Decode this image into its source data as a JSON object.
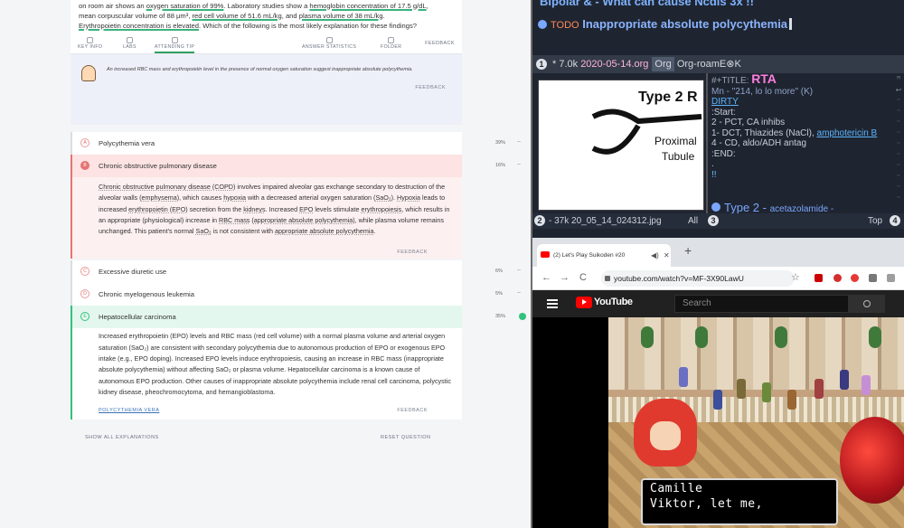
{
  "question": {
    "t1": "on room air shows an ",
    "h1": "oxygen saturation of 99%",
    "t2": ". Laboratory studies show a ",
    "h2": "hemoglobin concentration of 17.5 g/dL",
    "t3": ",",
    "t4": "mean corpuscular volume of 88 μm³, ",
    "h3": "red cell volume of 51.6 mL/kg",
    "t5": ", and ",
    "h4": "plasma volume of 38 mL/kg",
    "t6": ".",
    "h5": "Erythropoietin concentration is elevated",
    "t7": ". Which of the following is the most likely explanation for these findings?"
  },
  "toolbar": {
    "key_info": "KEY INFO",
    "labs": "LABS",
    "attending_tip": "ATTENDING TIP",
    "answer_statistics": "ANSWER STATISTICS",
    "folder": "FOLDER",
    "feedback": "FEEDBACK"
  },
  "tip": {
    "text": "An increased RBC mass and erythropoietin level in the presence of normal oxygen saturation suggest inappropriate absolute polycythemia.",
    "feedback": "FEEDBACK"
  },
  "options": [
    {
      "letter": "A",
      "label": "Polycythemia vera",
      "pct": "39%"
    },
    {
      "letter": "B",
      "label": "Chronic obstructive pulmonary disease",
      "pct": "16%"
    },
    {
      "letter": "C",
      "label": "Excessive diuretic use",
      "pct": "6%"
    },
    {
      "letter": "D",
      "label": "Chronic myelogenous leukemia",
      "pct": "5%"
    },
    {
      "letter": "E",
      "label": "Hepatocellular carcinoma",
      "pct": "35%"
    }
  ],
  "explB": {
    "p1": "Chronic obstructive pulmonary disease (COPD)",
    "p2": " involves impaired alveolar gas exchange secondary to destruction of the alveolar walls (",
    "p3": "emphysema",
    "p4": "), which causes ",
    "p5": "hypoxia",
    "p6": " with a decreased arterial oxygen saturation (",
    "p7": "SaO₂",
    "p8": "). ",
    "p9": "Hypoxia",
    "p10": " leads to increased ",
    "p11": "erythropoietin (EPO)",
    "p12": " secretion from the ",
    "p13": "kidneys",
    "p14": ". Increased ",
    "p15": "EPO",
    "p16": " levels stimulate ",
    "p17": "erythropoiesis",
    "p18": ", which results in an appropriate (physiological) increase in ",
    "p19": "RBC mass",
    "p20": " (",
    "p21": "appropriate absolute polycythemia",
    "p22": "), while plasma volume remains unchanged. This patient's normal ",
    "p23": "SaO₂",
    "p24": " is not consistent with ",
    "p25": "appropriate absolute polycythemia",
    "p26": ".",
    "feedback": "FEEDBACK"
  },
  "explE": {
    "text": "Increased erythropoietin (EPO) levels and RBC mass (red cell volume) with a normal plasma volume and arterial oxygen saturation (SaO₂) are consistent with secondary polycythemia due to autonomous production of EPO or exogenous EPO intake (e.g., EPO doping). Increased EPO levels induce erythropoiesis, causing an increase in RBC mass (inappropriate absolute polycythemia) without affecting SaO₂ or plasma volume. Hepatocellular carcinoma is a known cause of autonomous EPO production. Other causes of inappropriate absolute polycythemia include renal cell carcinoma, polycystic kidney disease, pheochromocytoma, and hemangioblastoma.",
    "related": "POLYCYTHEMIA VERA",
    "feedback": "FEEDBACK"
  },
  "footer": {
    "show_all": "SHOW ALL EXPLANATIONS",
    "reset": "RESET QUESTION"
  },
  "emacs": {
    "top_heading": "Bipolar & - What can cause Ncdis 3x !!",
    "todo_tag": "TODO",
    "todo_text": "Inappropriate absolute polycythemia",
    "mode1_num": "1",
    "mode1_file": "* 7.0k ",
    "mode1_date": "2020-05-14.org",
    "mode1_org": "Org",
    "mode1_roam": "Org-roam",
    "mode1_extra": "E⊗K",
    "img_type2": "Type 2 R",
    "img_proximal": "Proximal",
    "img_tubule": "Tubule",
    "lines": {
      "title_kw": "#+TITLE: ",
      "title": "RTA",
      "mn": "Mn - \"214, lo lo more\" (K)",
      "dirty": "DIRTY",
      "start": ":Start:",
      "l2": "2 - PCT, CA inhibs",
      "l1a": "1- DCT, Thiazides (NaCl), ",
      "l1b": "amphotericin B",
      "l4": "4 - CD, aldo/ADH antag",
      "end": ":END:",
      "dot": ".",
      "bang": "!!"
    },
    "type2_heading": "Type 2 - ",
    "type2_sub": "acetazolamide -",
    "mode2_num": "2",
    "mode2_file": "- 37k 20_05_14_024312.jpg",
    "mode2_all": "All",
    "mode2_n3": "3",
    "mode2_top": "Top",
    "mode2_n4": "4",
    "fringe": [
      "ꟸ",
      "↩",
      "⁻",
      "⁻",
      "⁻",
      "⁻",
      "⁻",
      "⁻",
      "⁻",
      "⁻",
      "⁻",
      "⁻",
      "⁻"
    ]
  },
  "browser": {
    "tab_title": "(2) Let's Play Suikoden #20",
    "tab_sound": "◀)",
    "tab_close": "✕",
    "newtab": "+",
    "back": "←",
    "forward": "→",
    "reload": "C",
    "url": "youtube.com/watch?v=MF-3X90LawU",
    "star": "☆",
    "yt_logo_text": "YouTube",
    "search_placeholder": "Search",
    "dialog_line1": "Camille",
    "dialog_line2": "Viktor,  let me,"
  }
}
